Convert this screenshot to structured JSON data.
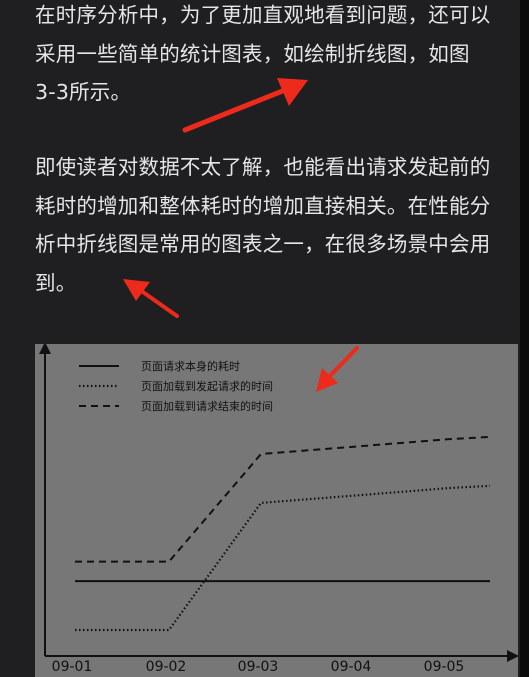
{
  "article": {
    "para1_lines": [
      "在时序分析中，为了更加直观地看到问题，还可以",
      "采用一些简单的统计图表，如绘制折线图，如图",
      "3-3所示。"
    ],
    "para2_lines": [
      "即使读者对数据不太了解，也能看出请求发起前的",
      "耗时的增加和整体耗时的增加直接相关。在性能分",
      "析中折线图是常用的图表之一，在很多场景中会用",
      "到。"
    ]
  },
  "colors": {
    "background": "#1f1f21",
    "text": "#e6e6e6",
    "figure_bg": "#777777",
    "line": "#111111",
    "annotation_arrow": "#ee2a1c"
  },
  "chart_data": {
    "type": "line",
    "categories": [
      "09-01",
      "09-02",
      "09-03",
      "09-04",
      "09-05"
    ],
    "series": [
      {
        "name": "页面请求本身的耗时",
        "style": "solid",
        "values": [
          1,
          1,
          1,
          1,
          1
        ]
      },
      {
        "name": "页面加载到发起请求的时间",
        "style": "dotted",
        "values": [
          0,
          0,
          2.6,
          2.75,
          2.9
        ]
      },
      {
        "name": "页面加载到请求结束的时间",
        "style": "dashed",
        "values": [
          1.4,
          1.4,
          3.6,
          3.75,
          3.9
        ]
      }
    ],
    "ylim": [
      0,
      4.5
    ],
    "legend": "top-left",
    "grid": false
  }
}
